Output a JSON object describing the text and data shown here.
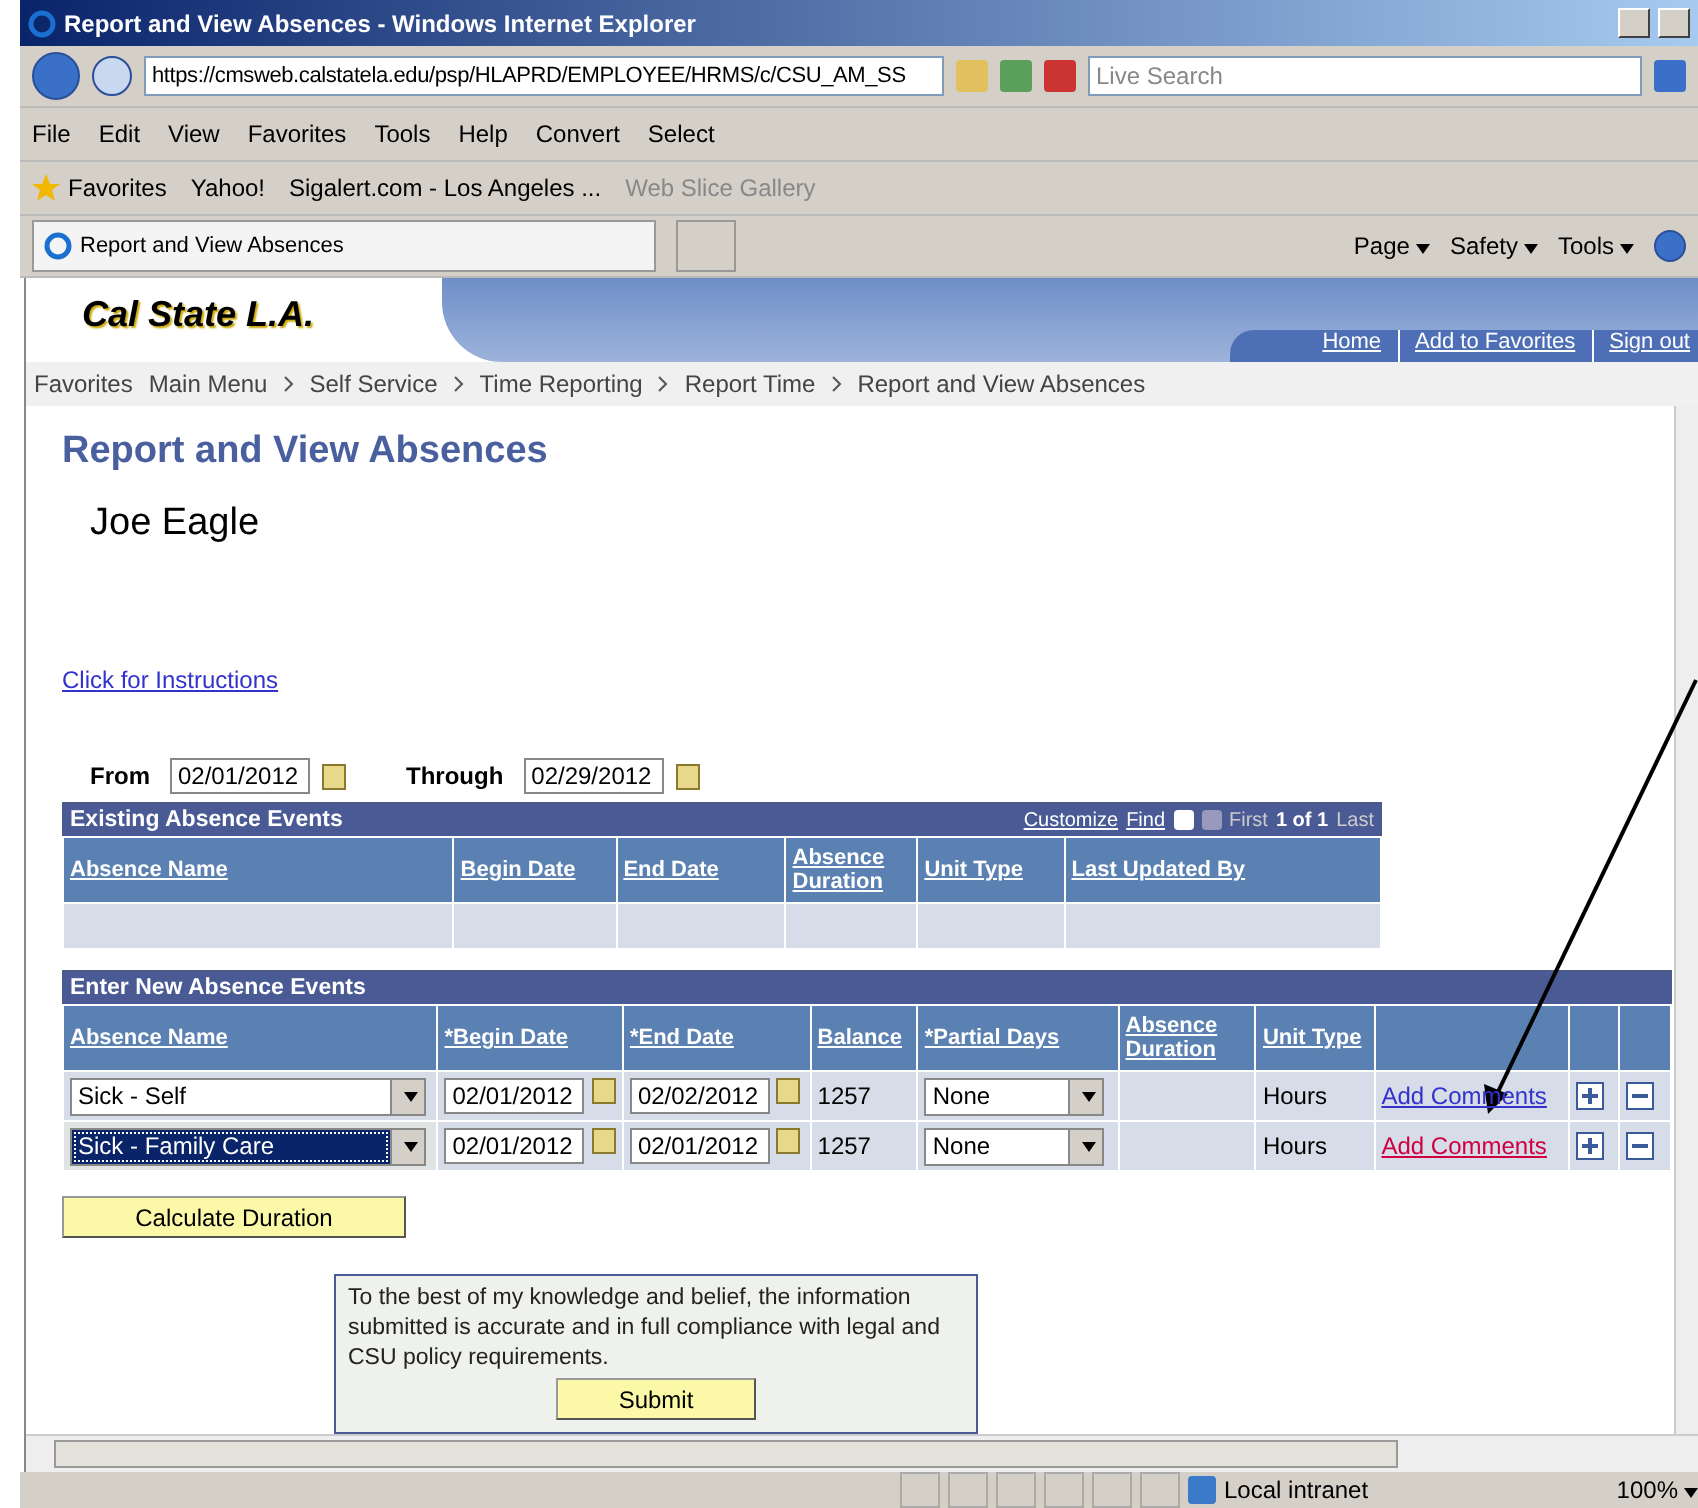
{
  "window": {
    "title": "Report and View Absences - Windows Internet Explorer"
  },
  "address_bar": {
    "url": "https://cmsweb.calstatela.edu/psp/HLAPRD/EMPLOYEE/HRMS/c/CSU_AM_SS",
    "search_placeholder": "Live Search"
  },
  "menu_bar": [
    "File",
    "Edit",
    "View",
    "Favorites",
    "Tools",
    "Help"
  ],
  "command_bar": [
    "Convert",
    "Select"
  ],
  "favorites_bar": {
    "label": "Favorites",
    "links": [
      {
        "label": "Yahoo!",
        "disabled": false
      },
      {
        "label": "Sigalert.com - Los Angeles ...",
        "disabled": false
      },
      {
        "label": "Web Slice Gallery",
        "disabled": true
      }
    ]
  },
  "tab": {
    "label": "Report and View Absences"
  },
  "toolbar": [
    "Page",
    "Safety",
    "Tools"
  ],
  "page": {
    "logo": "Cal State L.A.",
    "header_links": [
      "Home",
      "Add to Favorites",
      "Sign out"
    ],
    "breadcrumbs": [
      "Favorites",
      "Main Menu",
      "Self Service",
      "Time Reporting",
      "Report Time",
      "Report and View Absences"
    ],
    "heading": "Report and View Absences",
    "employee": "Joe Eagle",
    "instructions_link": "Click for Instructions",
    "from": {
      "label": "From",
      "value": "02/01/2012"
    },
    "through": {
      "label": "Through",
      "value": "02/29/2012"
    },
    "existing": {
      "title": "Existing Absence Events",
      "links": [
        "Customize",
        "Find"
      ],
      "first": "First",
      "count": "1 of 1",
      "last": "Last",
      "columns": [
        "Absence Name",
        "Begin Date",
        "End Date",
        "Absence Duration",
        "Unit Type",
        "Last Updated By"
      ]
    },
    "new_events": {
      "title": "Enter New Absence Events",
      "columns": [
        "Absence Name",
        "*Begin Date",
        "*End Date",
        "Balance",
        "*Partial Days",
        "Absence Duration",
        "Unit Type"
      ],
      "rows": [
        {
          "absence_name": "Sick - Self",
          "begin_date": "02/01/2012",
          "end_date": "02/02/2012",
          "balance": "1257",
          "partial_days": "None",
          "unit_type": "Hours",
          "comments_link": "Add Comments",
          "selected": false
        },
        {
          "absence_name": "Sick - Family Care",
          "begin_date": "02/01/2012",
          "end_date": "02/01/2012",
          "balance": "1257",
          "partial_days": "None",
          "unit_type": "Hours",
          "comments_link": "Add Comments",
          "selected": true
        }
      ]
    },
    "calculate_button": "Calculate Duration",
    "attestation": {
      "text": "To the best of my knowledge and belief, the information submitted is accurate and in full compliance with legal and CSU policy requirements.",
      "button": "Submit"
    }
  },
  "status_bar": {
    "zone": "Local intranet",
    "zoom": "100%"
  }
}
